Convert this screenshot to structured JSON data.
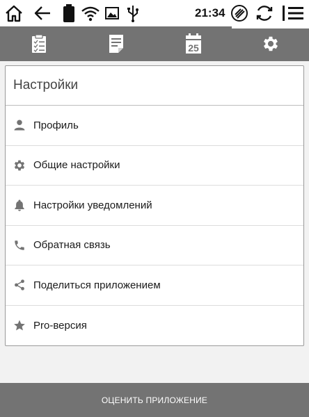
{
  "status_bar": {
    "time": "21:34",
    "icons": [
      "home-icon",
      "back-arrow-icon",
      "battery-icon",
      "wifi-icon",
      "image-icon",
      "usb-icon",
      "cleaner-icon",
      "refresh-icon",
      "menu-icon"
    ]
  },
  "tabs": [
    {
      "name": "checklist",
      "icon": "checklist-icon",
      "active": false
    },
    {
      "name": "notes",
      "icon": "document-icon",
      "active": false
    },
    {
      "name": "calendar",
      "icon": "calendar-icon",
      "label": "25",
      "active": false
    },
    {
      "name": "settings",
      "icon": "gear-icon",
      "active": true
    }
  ],
  "settings": {
    "title": "Настройки",
    "items": [
      {
        "label": "Профиль",
        "icon": "person-icon"
      },
      {
        "label": "Общие настройки",
        "icon": "gear-icon"
      },
      {
        "label": "Настройки уведомлений",
        "icon": "bell-icon"
      },
      {
        "label": "Обратная связь",
        "icon": "phone-icon"
      },
      {
        "label": "Поделиться приложением",
        "icon": "share-icon"
      },
      {
        "label": "Pro-версия",
        "icon": "star-icon"
      }
    ]
  },
  "rate_button": {
    "label": "ОЦЕНИТЬ ПРИЛОЖЕНИЕ"
  },
  "colors": {
    "bar": "#737373",
    "background": "#f2f2f2",
    "card": "#ffffff"
  }
}
